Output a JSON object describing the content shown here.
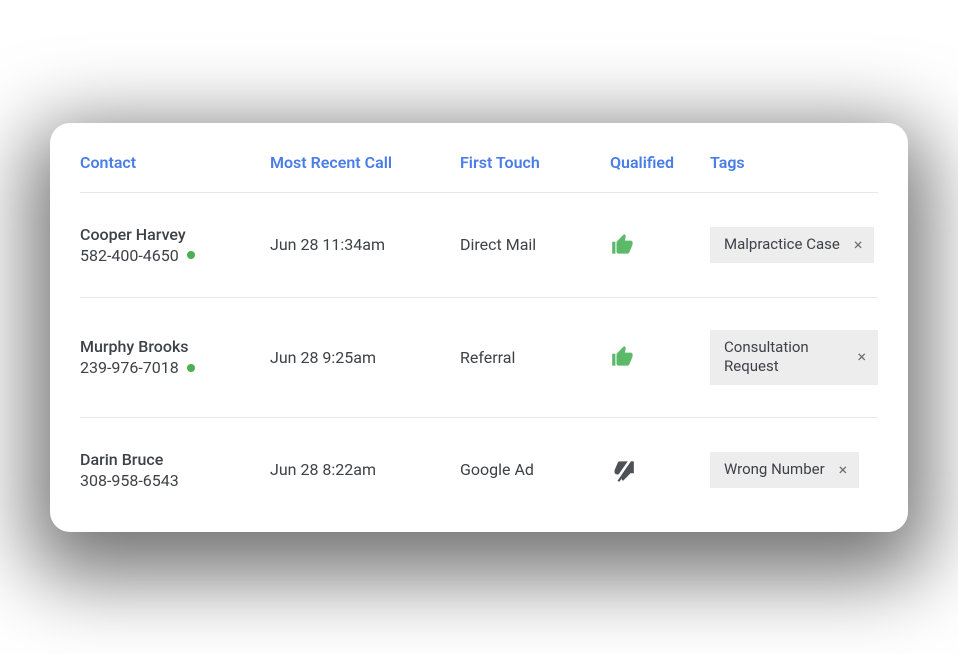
{
  "headers": {
    "contact": "Contact",
    "recent": "Most Recent Call",
    "touch": "First Touch",
    "qualified": "Qualified",
    "tags": "Tags"
  },
  "rows": [
    {
      "name": "Cooper Harvey",
      "phone": "582-400-4650",
      "has_dot": true,
      "recent": "Jun 28 11:34am",
      "touch": "Direct Mail",
      "qualified": "up",
      "tag": "Malpractice Case"
    },
    {
      "name": "Murphy Brooks",
      "phone": "239-976-7018",
      "has_dot": true,
      "recent": "Jun 28 9:25am",
      "touch": "Referral",
      "qualified": "up",
      "tag": "Consultation Request"
    },
    {
      "name": "Darin Bruce",
      "phone": "308-958-6543",
      "has_dot": false,
      "recent": "Jun 28 8:22am",
      "touch": "Google Ad",
      "qualified": "down",
      "tag": "Wrong Number"
    }
  ],
  "colors": {
    "accent": "#4a7de8",
    "thumb_up": "#5cb96a",
    "thumb_down": "#4c5057"
  }
}
